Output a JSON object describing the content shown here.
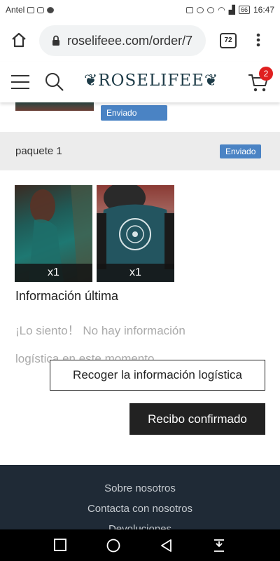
{
  "status_bar": {
    "carrier": "Antel",
    "battery": "66",
    "time": "16:47"
  },
  "browser": {
    "url": "roselifeee.com/order/7",
    "tab_count": "72"
  },
  "header": {
    "logo": "❦ROSELIFEE❦",
    "cart_count": "2"
  },
  "previous_item": {
    "status": "Enviado"
  },
  "package": {
    "title": "paquete 1",
    "status": "Enviado",
    "items": [
      {
        "qty": "x1"
      },
      {
        "qty": "x1"
      }
    ]
  },
  "logistics": {
    "title": "Información última",
    "message": "¡Lo siento！ No hay información logística en este momento",
    "collect_label": "Recoger la información logística",
    "confirm_label": "Recibo confirmado"
  },
  "footer": {
    "links": [
      "Sobre nosotros",
      "Contacta con nosotros",
      "Devoluciones"
    ]
  },
  "colors": {
    "accent_blue": "#4a83c4",
    "badge_red": "#e02020",
    "footer_bg": "#1f2a36"
  }
}
